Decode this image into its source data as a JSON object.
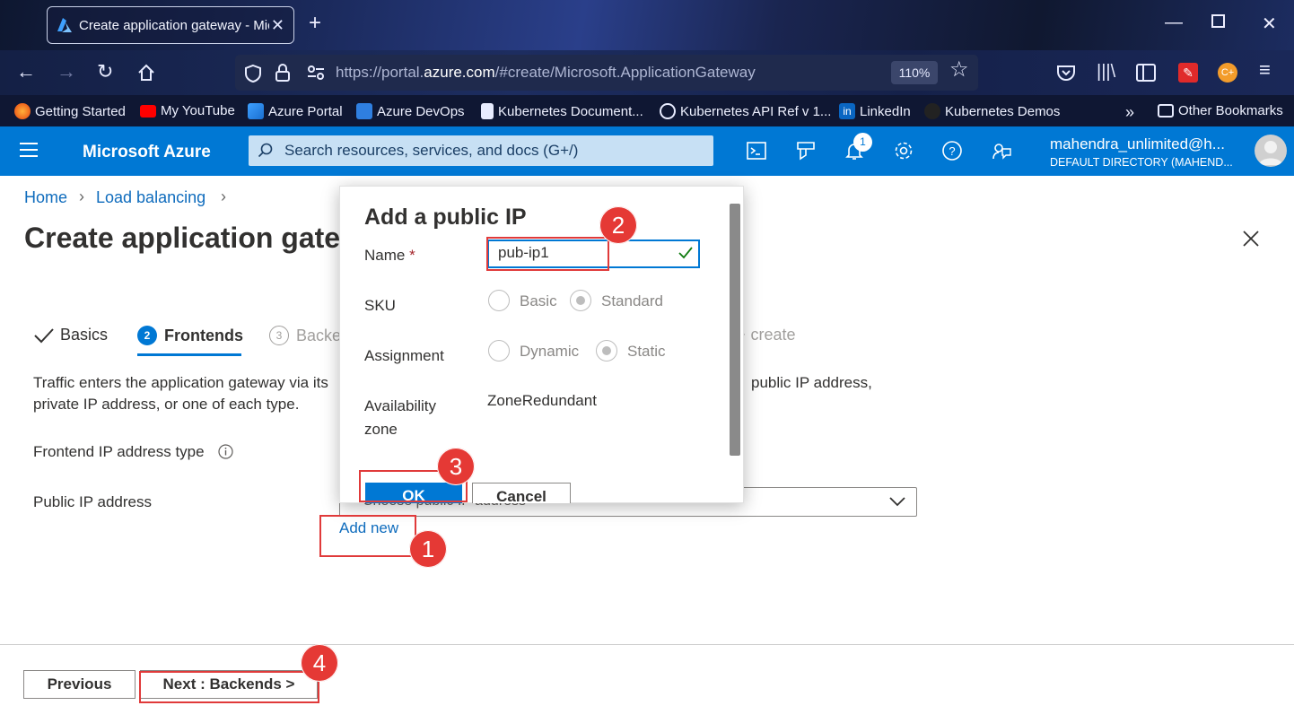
{
  "browser": {
    "tab_title": "Create application gateway - Micro",
    "url_prefix": "https://portal.",
    "url_domain": "azure.com",
    "url_suffix": "/#create/Microsoft.ApplicationGateway",
    "zoom": "110%",
    "bookmarks": [
      "Getting Started",
      "My YouTube",
      "Azure Portal",
      "Azure DevOps",
      "Kubernetes Document...",
      "Kubernetes API Ref v 1...",
      "LinkedIn",
      "Kubernetes Demos",
      "Other Bookmarks"
    ]
  },
  "azure": {
    "brand": "Microsoft Azure",
    "search_placeholder": "Search resources, services, and docs (G+/)",
    "notification_count": "1",
    "user_email": "mahendra_unlimited@h...",
    "user_directory": "DEFAULT DIRECTORY (MAHEND..."
  },
  "breadcrumb": [
    "Home",
    "Load balancing"
  ],
  "page_title": "Create application gatew",
  "steps": [
    {
      "label": "Basics"
    },
    {
      "num": "2",
      "label": "Frontends"
    },
    {
      "num": "3",
      "label": "Backe"
    },
    {
      "label": "create"
    }
  ],
  "description": {
    "line1": "Traffic enters the application gateway via its",
    "line1_end": "public IP address,",
    "line2": "private IP address, or one of each type."
  },
  "form": {
    "frontend_type_label": "Frontend IP address type",
    "public_ip_label": "Public IP address",
    "public_ip_placeholder": "Choose public IP address",
    "add_new": "Add new"
  },
  "footer": {
    "previous": "Previous",
    "next": "Next : Backends >"
  },
  "dialog": {
    "title": "Add a public IP",
    "name_label": "Name",
    "name_required": "*",
    "name_value": "pub-ip1",
    "sku_label": "SKU",
    "sku_options": [
      "Basic",
      "Standard"
    ],
    "sku_selected": "Standard",
    "assignment_label": "Assignment",
    "assignment_options": [
      "Dynamic",
      "Static"
    ],
    "assignment_selected": "Static",
    "zone_label_1": "Availability",
    "zone_label_2": "zone",
    "zone_value": "ZoneRedundant",
    "ok": "OK",
    "cancel": "Cancel"
  },
  "annotations": [
    "1",
    "2",
    "3",
    "4"
  ],
  "colors": {
    "azure_blue": "#0078d4",
    "annotation_red": "#e53935"
  }
}
